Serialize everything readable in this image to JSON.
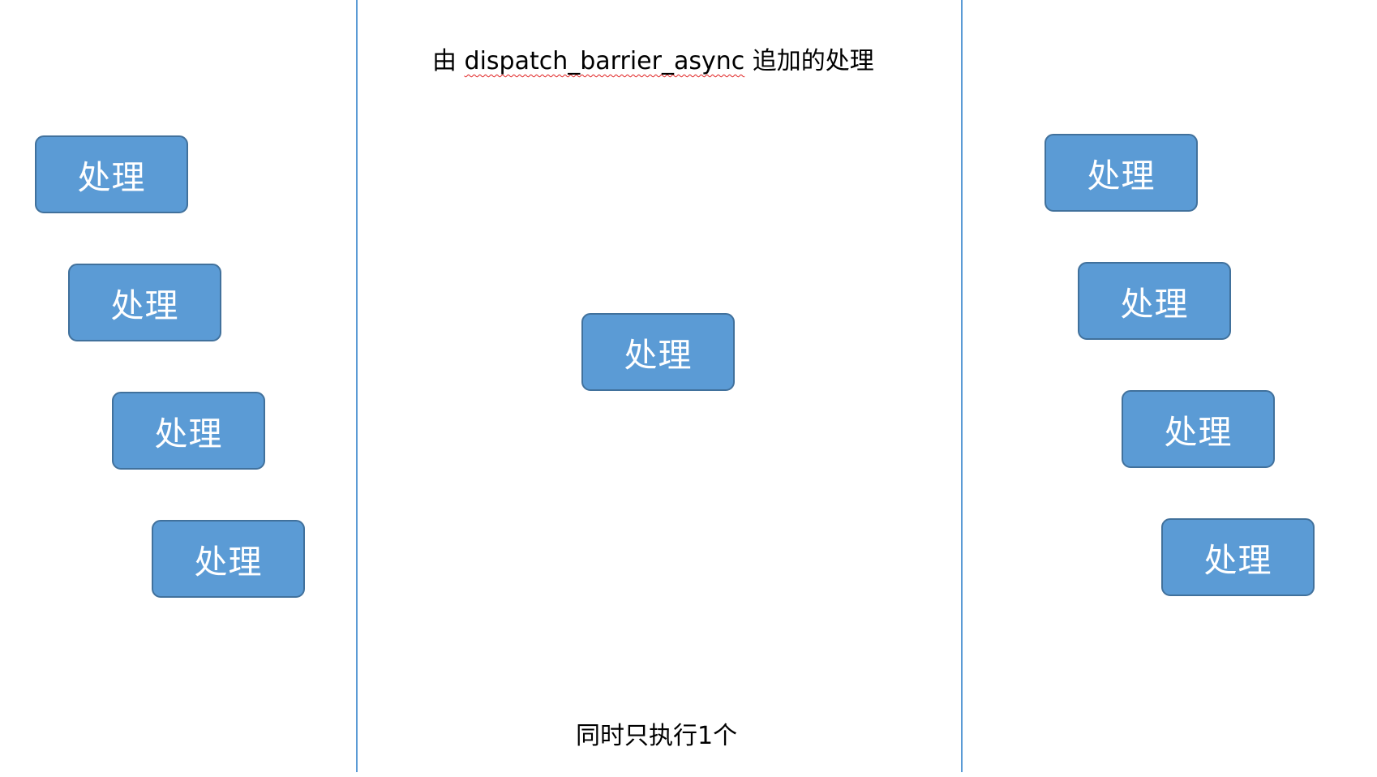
{
  "colors": {
    "box_fill": "#5b9bd5",
    "box_border": "#41719c",
    "divider": "#5b9bd5",
    "box_text": "#ffffff",
    "spellcheck_underline": "#e02020"
  },
  "top_caption": {
    "prefix": "由",
    "code": "dispatch_barrier_async",
    "suffix": "追加的处理"
  },
  "bottom_caption": "同时只执行1个",
  "left_column": {
    "boxes": [
      {
        "label": "处理"
      },
      {
        "label": "处理"
      },
      {
        "label": "处理"
      },
      {
        "label": "处理"
      }
    ]
  },
  "center_column": {
    "box": {
      "label": "处理"
    }
  },
  "right_column": {
    "boxes": [
      {
        "label": "处理"
      },
      {
        "label": "处理"
      },
      {
        "label": "处理"
      },
      {
        "label": "处理"
      }
    ]
  }
}
